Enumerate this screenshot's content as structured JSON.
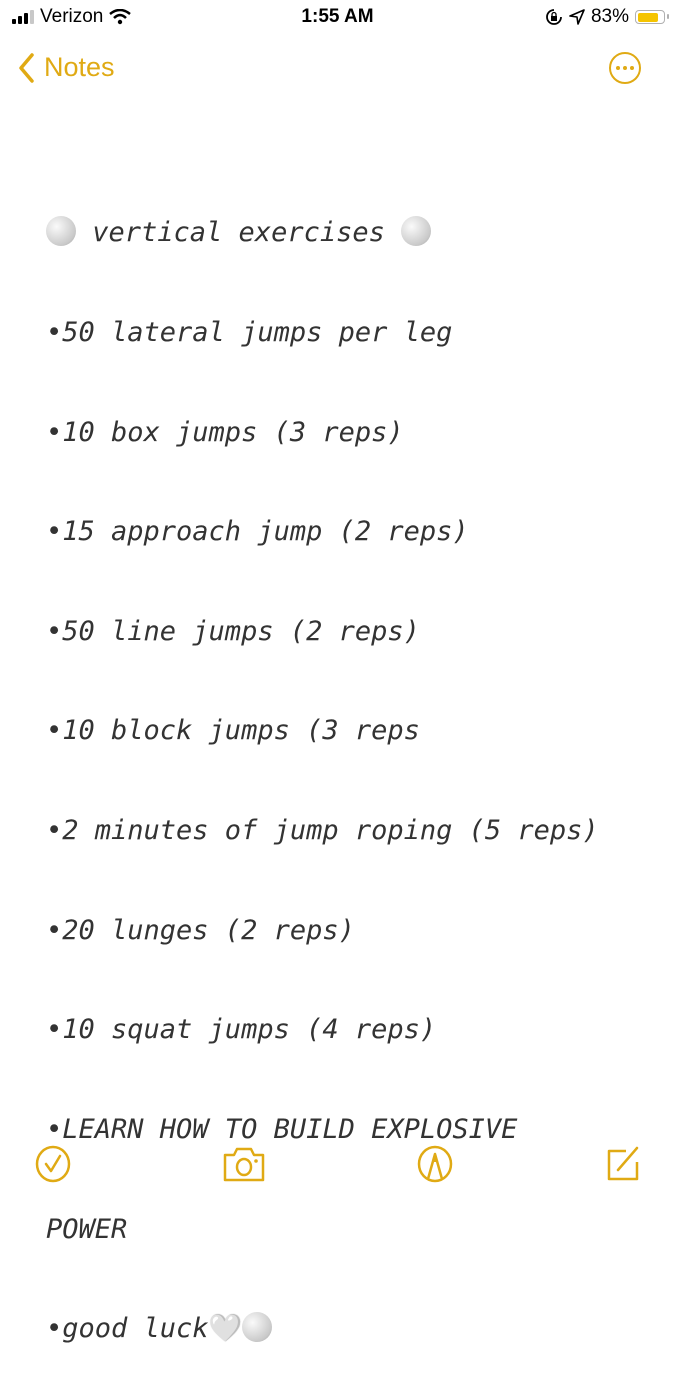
{
  "status_bar": {
    "carrier": "Verizon",
    "time": "1:55 AM",
    "battery_percent": "83%",
    "battery_level": 0.83,
    "icons": [
      "cellular-signal-icon",
      "wifi-icon",
      "orientation-lock-icon",
      "location-arrow-icon",
      "battery-icon"
    ]
  },
  "nav": {
    "back_label": "Notes",
    "back_icon": "chevron-left-icon",
    "more_icon": "ellipsis-circle-icon"
  },
  "note": {
    "title": " vertical exercises ",
    "title_emoji": "volleyball",
    "lines": [
      "•50 lateral jumps per leg",
      "•10 box jumps (3 reps)",
      "•15 approach jump (2 reps)",
      "•50 line jumps (2 reps)",
      "•10 block jumps (3 reps",
      "•2 minutes of jump roping (5 reps)",
      "•20 lunges (2 reps)",
      "•10 squat jumps (4 reps)",
      "•LEARN HOW TO BUILD EXPLOSIVE",
      "POWER"
    ],
    "closing": "•good luck",
    "closing_emojis": [
      "white-heart",
      "volleyball"
    ],
    "heart_glyph": "🤍"
  },
  "toolbar": {
    "items": [
      "checklist-icon",
      "camera-icon",
      "markup-icon",
      "compose-icon"
    ]
  },
  "colors": {
    "accent": "#e0aa14",
    "text": "#333333"
  }
}
